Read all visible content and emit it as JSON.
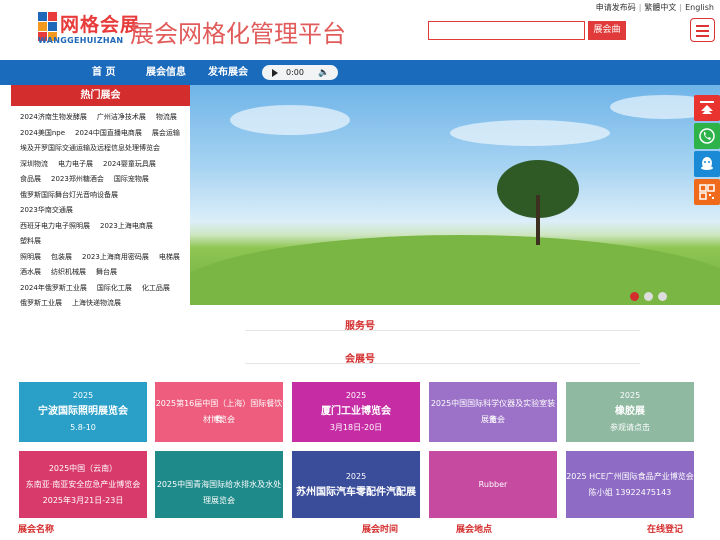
{
  "toplinks": {
    "publish": "申请发布码",
    "trad": "繁體中文",
    "english": "English"
  },
  "logo": {
    "name": "网格会展",
    "pinyin": "WANGGEHUIZHAN"
  },
  "site_title": "展会网格化管理平台",
  "search": {
    "placeholder": "",
    "button": "展会曲"
  },
  "nav": {
    "home": "首 页",
    "info": "展会信息",
    "publish": "发布展会"
  },
  "audio": {
    "time": "0:00"
  },
  "hot": {
    "title": "热门展会",
    "rows": [
      [
        "2024济南生物发酵展",
        "广州洁净技术展",
        "物流展"
      ],
      [
        "2024美国npe",
        "2024中国直播电商展",
        "展会运输"
      ],
      [
        "埃及开罗国际交通运输及远程信息处理博览会"
      ],
      [
        "深圳物流",
        "电力电子展",
        "2024婴童玩具展"
      ],
      [
        "食品展",
        "2023郑州糖酒会",
        "国际宠物展"
      ],
      [
        "俄罗斯国际舞台灯光音响设备展",
        "2023华南交通展"
      ],
      [
        "西班牙电力电子照明展",
        "2023上海电商展",
        "塑料展"
      ],
      [
        "照明展",
        "包装展",
        "2023上海商用密码展",
        "电梯展"
      ],
      [
        "酒水展",
        "纺织机械展",
        "舞台展"
      ],
      [
        "2024年俄罗斯工业展",
        "国际化工展",
        "化工品展"
      ],
      [
        "俄罗斯工业展",
        "上海快递物流展"
      ]
    ]
  },
  "sections": {
    "service": "服务号",
    "expo": "会展号"
  },
  "cards": [
    {
      "t1": "2025",
      "t2": "宁波国际照明展览会",
      "t3": "5.8-10",
      "color": "#2aa0c8"
    },
    {
      "t1": "2025第16届中国（上海）国际餐饮食",
      "t2": "材博览会",
      "t3": "",
      "color": "#ee5d7d"
    },
    {
      "t1": "2025",
      "t2": "厦门工业博览会",
      "t3": "3月18日-20日",
      "color": "#c62da5"
    },
    {
      "t1": "2025中国国际科学仪器及实验室装备",
      "t2": "展览会",
      "t3": "",
      "color": "#9b72c8"
    },
    {
      "t1": "2025",
      "t2": "橡胶展",
      "t3": "参观请点击",
      "color": "#8fb9a1"
    },
    {
      "t1": "2025中国（云南）",
      "t2": "东南亚·南亚安全应急产业博览会",
      "t3": "2025年3月21日-23日",
      "color": "#d83a6c"
    },
    {
      "t1": "2025中国青海国际给水排水及水处理展览会",
      "t2": "",
      "t3": "",
      "color": "#1e8a8a"
    },
    {
      "t1": "2025",
      "t2": "苏州国际汽车零配件汽配展",
      "t3": "",
      "color": "#3a4d9b"
    },
    {
      "t1": "Rubber",
      "t2": "",
      "t3": "",
      "color": "#c64aa0"
    },
    {
      "t1": "2025 HCE广州国际食品产业博览会",
      "t2": "陈小姐 13922475143",
      "t3": "",
      "color": "#8e6bc4"
    }
  ],
  "footer": {
    "name": "展会名称",
    "time": "展会时间",
    "place": "展会地点",
    "register": "在线登记"
  }
}
